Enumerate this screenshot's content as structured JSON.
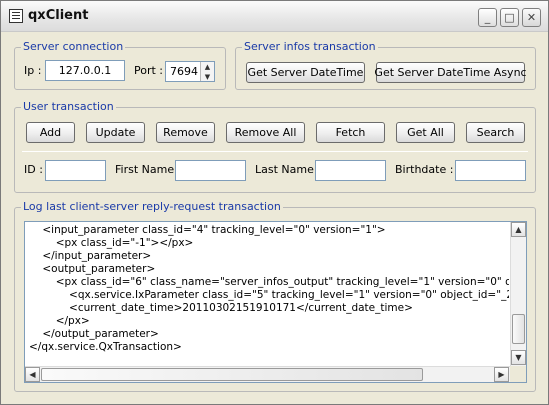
{
  "window": {
    "title": "qxClient",
    "controls": {
      "minimize": "_",
      "maximize": "□",
      "close": "✕"
    }
  },
  "server_connection": {
    "title": "Server connection",
    "ip_label": "Ip :",
    "ip_value": "127.0.0.1",
    "port_label": "Port :",
    "port_value": "7694"
  },
  "server_infos": {
    "title": "Server infos transaction",
    "get_datetime": "Get Server DateTime",
    "get_datetime_async": "Get Server DateTime Async"
  },
  "user_transaction": {
    "title": "User transaction",
    "buttons": {
      "add": "Add",
      "update": "Update",
      "remove": "Remove",
      "remove_all": "Remove All",
      "fetch": "Fetch",
      "get_all": "Get All",
      "search": "Search"
    },
    "fields": {
      "id_label": "ID :",
      "id_value": "",
      "first_name_label": "First Name :",
      "first_name_value": "",
      "last_name_label": "Last Name :",
      "last_name_value": "",
      "birthdate_label": "Birthdate :",
      "birthdate_value": ""
    }
  },
  "log": {
    "title": "Log last client-server reply-request transaction",
    "text": "    <input_parameter class_id=\"4\" tracking_level=\"0\" version=\"1\">\n        <px class_id=\"-1\"></px>\n    </input_parameter>\n    <output_parameter>\n        <px class_id=\"6\" class_name=\"server_infos_output\" tracking_level=\"1\" version=\"0\" object_id=\n            <qx.service.IxParameter class_id=\"5\" tracking_level=\"1\" version=\"0\" object_id=\"_2\"></qx\n            <current_date_time>20110302151910171</current_date_time>\n        </px>\n    </output_parameter>\n</qx.service.QxTransaction>"
  },
  "icons": {
    "app": "app-icon",
    "arrow_up": "▲",
    "arrow_down": "▼",
    "arrow_left": "◀",
    "arrow_right": "▶"
  },
  "colors": {
    "group_title": "#1a3aa8",
    "window_bg": "#ece9d8",
    "input_border": "#7f9db9"
  }
}
